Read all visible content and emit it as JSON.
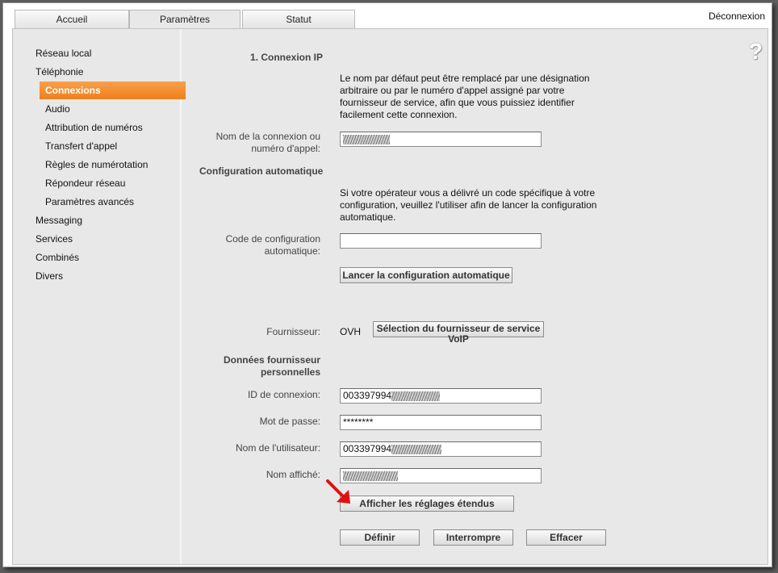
{
  "tabs": [
    {
      "label": "Accueil"
    },
    {
      "label": "Paramètres"
    },
    {
      "label": "Statut"
    }
  ],
  "logout_label": "Déconnexion",
  "help_glyph": "?",
  "sidebar": {
    "items": [
      {
        "label": "Réseau local"
      },
      {
        "label": "Téléphonie"
      },
      {
        "label": "Connexions"
      },
      {
        "label": "Audio"
      },
      {
        "label": "Attribution de numéros"
      },
      {
        "label": "Transfert d'appel"
      },
      {
        "label": "Règles de numérotation"
      },
      {
        "label": "Répondeur réseau"
      },
      {
        "label": "Paramètres avancés"
      },
      {
        "label": "Messaging"
      },
      {
        "label": "Services"
      },
      {
        "label": "Combinés"
      },
      {
        "label": "Divers"
      }
    ],
    "active": "Connexions"
  },
  "form": {
    "section1_title": "1. Connexion IP",
    "intro_text": "Le nom par défaut peut être remplacé par une désignation arbitraire ou par le numéro d'appel assigné par votre fournisseur de service, afin que vous puissiez identifier facilement cette connexion.",
    "connection_name_label_1": "Nom de la connexion ou",
    "connection_name_label_2": "numéro d'appel:",
    "auto_config_title": "Configuration automatique",
    "auto_config_text": "Si votre opérateur vous a délivré un code spécifique à votre configuration, veuillez l'utiliser afin de lancer la configuration automatique.",
    "auto_code_label_1": "Code de configuration",
    "auto_code_label_2": "automatique:",
    "auto_code_value": "",
    "launch_auto_button": "Lancer la configuration automatique",
    "provider_label": "Fournisseur:",
    "provider_value": "OVH",
    "select_provider_button_1": "Sélection du fournisseur de service",
    "select_provider_button_2": "VoIP",
    "personal_data_title_1": "Données fournisseur",
    "personal_data_title_2": "personnelles",
    "login_id_label": "ID de connexion:",
    "login_id_value": "003397994",
    "password_label": "Mot de passe:",
    "password_value": "********",
    "username_label": "Nom de l'utilisateur:",
    "username_value": "003397994",
    "display_name_label": "Nom affiché:",
    "show_extended_button": "Afficher les réglages étendus",
    "define_button": "Définir",
    "cancel_button": "Interrompre",
    "clear_button": "Effacer"
  },
  "colors": {
    "accent_orange": "#f07f1a",
    "arrow_red": "#e01010",
    "panel_bg": "#e8e8e8"
  }
}
